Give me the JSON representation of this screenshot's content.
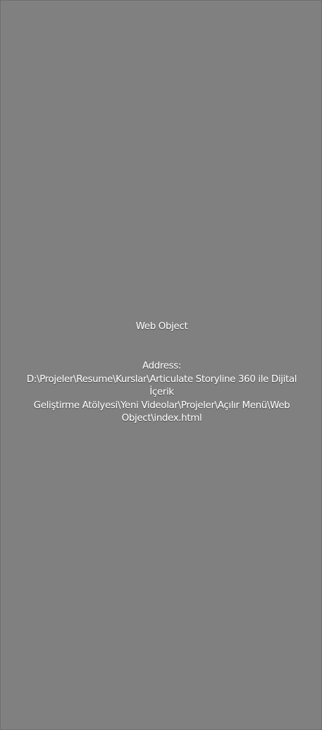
{
  "web_object": {
    "title": "Web Object",
    "address_label": "Address:",
    "address_lines": [
      "D:\\Projeler\\Resume\\Kurslar\\Articulate Storyline 360 ile Dijital İçerik",
      "Geliştirme Atölyesi\\Yeni Videolar\\Projeler\\Açılır Menü\\Web",
      "Object\\index.html"
    ]
  }
}
